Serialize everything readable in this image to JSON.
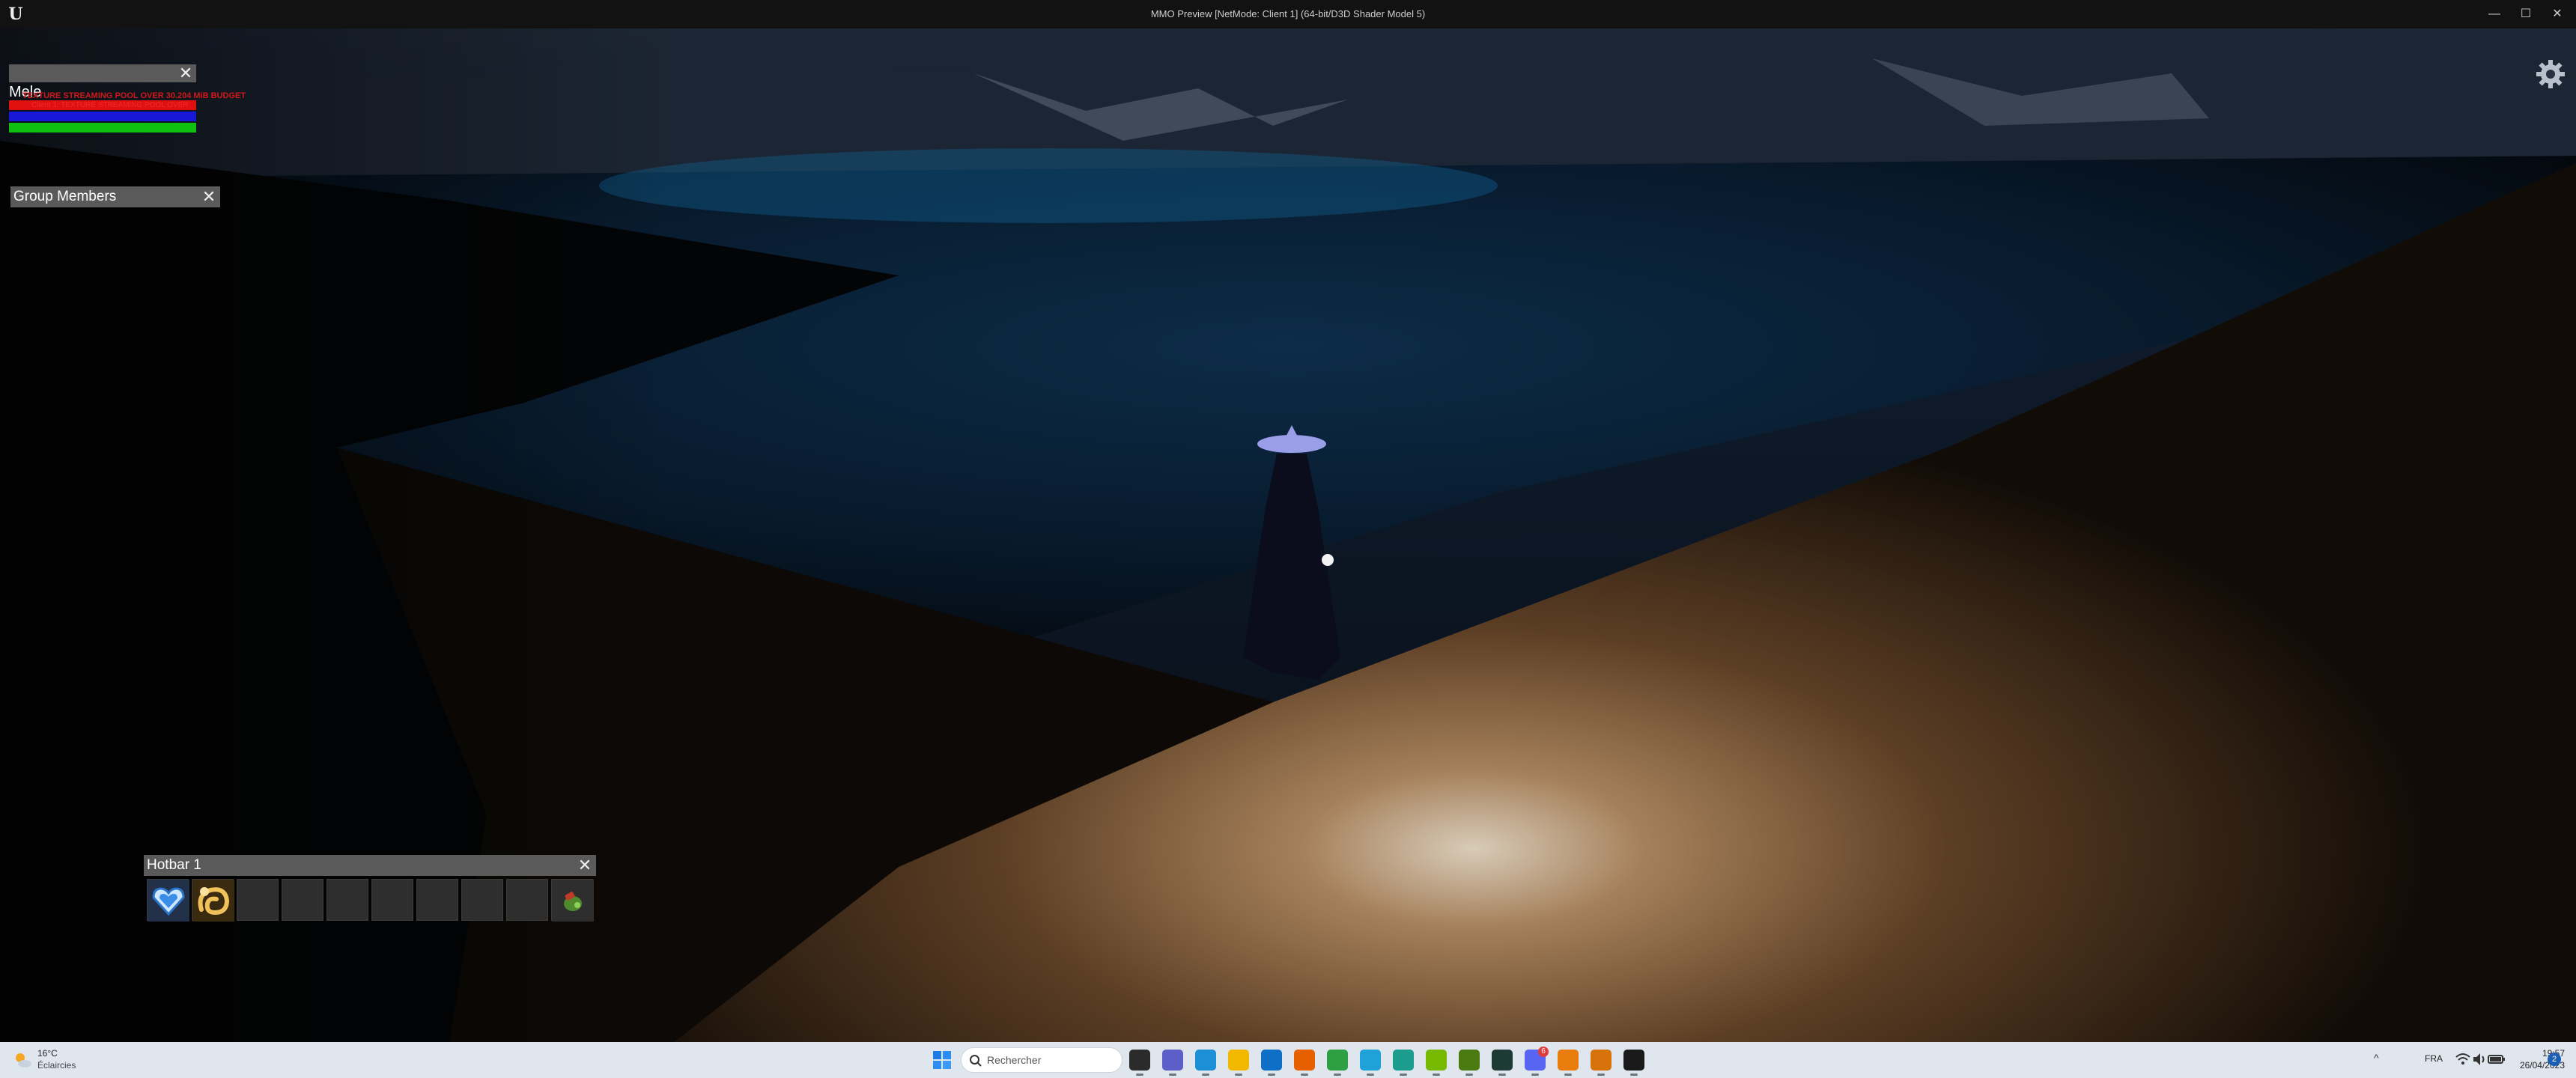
{
  "window": {
    "title": "MMO Preview [NetMode: Client 1]  (64-bit/D3D Shader Model 5)",
    "logo_letter": "U",
    "minimize_glyph": "—",
    "maximize_glyph": "☐",
    "close_glyph": "✕"
  },
  "hud": {
    "player_frame": {
      "name": "Mele",
      "close_glyph": "✕",
      "streaming_warning": "TEXTURE STREAMING POOL OVER 30.204 MiB BUDGET",
      "debug_text": "Client 1: TEXTURE STREAMING POOL OVER",
      "health_fraction": 1.0,
      "mana_fraction": 1.0,
      "stamina_fraction": 1.0,
      "colors": {
        "health": "#e01010",
        "mana": "#1818d8",
        "stamina": "#10c010"
      }
    },
    "group_panel": {
      "title": "Group Members",
      "close_glyph": "✕"
    },
    "hotbar": {
      "title": "Hotbar 1",
      "close_glyph": "✕",
      "slots": [
        {
          "icon": "heart-gem-icon"
        },
        {
          "icon": "golden-swirl-icon"
        },
        {
          "icon": ""
        },
        {
          "icon": ""
        },
        {
          "icon": ""
        },
        {
          "icon": ""
        },
        {
          "icon": ""
        },
        {
          "icon": ""
        },
        {
          "icon": ""
        },
        {
          "icon": "potion-pouch-icon"
        }
      ]
    },
    "settings_icon": "gear-icon"
  },
  "taskbar": {
    "weather": {
      "temp": "16°C",
      "desc": "Éclaircies",
      "icon": "partly-sunny-icon"
    },
    "search_placeholder": "Rechercher",
    "apps": [
      {
        "name": "task-view",
        "color": "#2b2b2b"
      },
      {
        "name": "teams",
        "color": "#5b5fc7"
      },
      {
        "name": "edge",
        "color": "#1d8fd6"
      },
      {
        "name": "file-explorer",
        "color": "#f2b900"
      },
      {
        "name": "mail",
        "color": "#0e6fc7"
      },
      {
        "name": "firefox",
        "color": "#e66000"
      },
      {
        "name": "chrome",
        "color": "#2ea043"
      },
      {
        "name": "app-blue",
        "color": "#1fa2d8"
      },
      {
        "name": "app-teal",
        "color": "#1c9c8c"
      },
      {
        "name": "nvidia",
        "color": "#76b900"
      },
      {
        "name": "nvidia-geforce",
        "color": "#4a7a10"
      },
      {
        "name": "app-dark-circle",
        "color": "#1e3a34"
      },
      {
        "name": "discord",
        "color": "#5865f2"
      },
      {
        "name": "blender",
        "color": "#e87d0d"
      },
      {
        "name": "blender-2",
        "color": "#d8730c"
      },
      {
        "name": "unreal-engine",
        "color": "#1a1a1a"
      }
    ],
    "discord_badge": "6",
    "tray": {
      "chevron": "^",
      "language": "FRA",
      "time": "19:57",
      "date": "26/04/2023",
      "notification_count": "2"
    }
  }
}
